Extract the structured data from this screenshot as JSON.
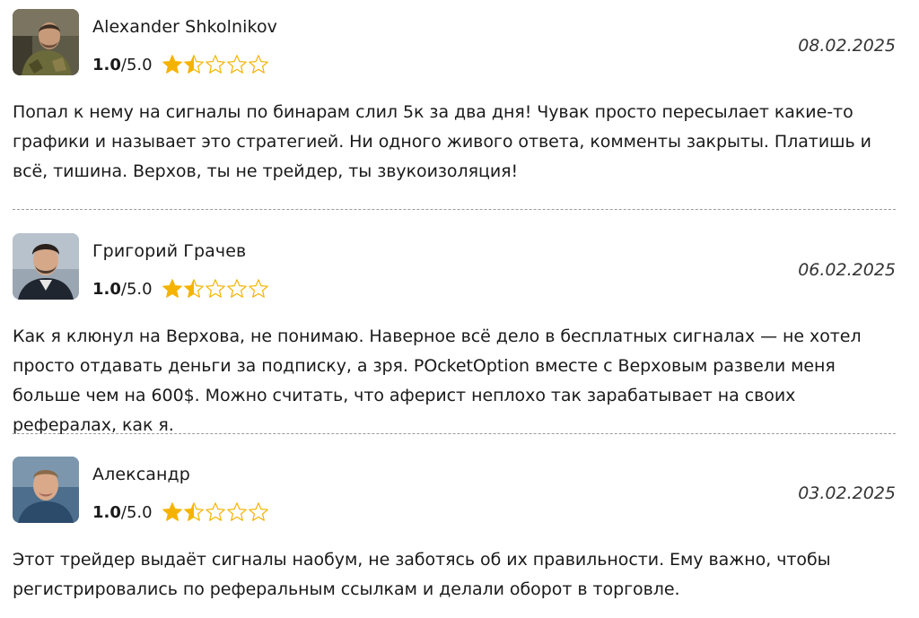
{
  "colors": {
    "star_fill": "#f5b301",
    "star_outline": "#f5b301",
    "divider": "#9a9a9a",
    "text": "#1a1a1a"
  },
  "reviews": [
    {
      "author": "Alexander Shkolnikov",
      "rating_value": "1.0",
      "rating_sep": "/",
      "rating_max": "5.0",
      "stars_filled": 1.5,
      "date": "08.02.2025",
      "avatar_icon": "user-photo-icon",
      "text": "Попал к нему на сигналы по бинарам слил 5к за два дня! Чувак просто пересылает какие-то графики и называет это стратегией. Ни одного живого ответа, комменты закрыты. Платишь и всё, тишина. Верхов, ты не трейдер, ты звукоизоляция!"
    },
    {
      "author": "Григорий Грачев",
      "rating_value": "1.0",
      "rating_sep": "/",
      "rating_max": "5.0",
      "stars_filled": 1.5,
      "date": "06.02.2025",
      "avatar_icon": "user-photo-icon",
      "text": "Как я клюнул на Верхова, не понимаю. Наверное всё дело в бесплатных сигналах — не хотел просто отдавать деньги за подписку, а зря. POcketOption вместе с Верховым развели меня больше чем на 600$. Можно считать, что аферист неплохо так зарабатывает на своих рефералах, как я."
    },
    {
      "author": "Александр",
      "rating_value": "1.0",
      "rating_sep": "/",
      "rating_max": "5.0",
      "stars_filled": 1.5,
      "date": "03.02.2025",
      "avatar_icon": "user-photo-icon",
      "text": "Этот трейдер выдаёт сигналы наобум, не заботясь об их правильности. Ему важно, чтобы регистрировались по реферальным ссылкам и делали оборот в торговле."
    }
  ]
}
